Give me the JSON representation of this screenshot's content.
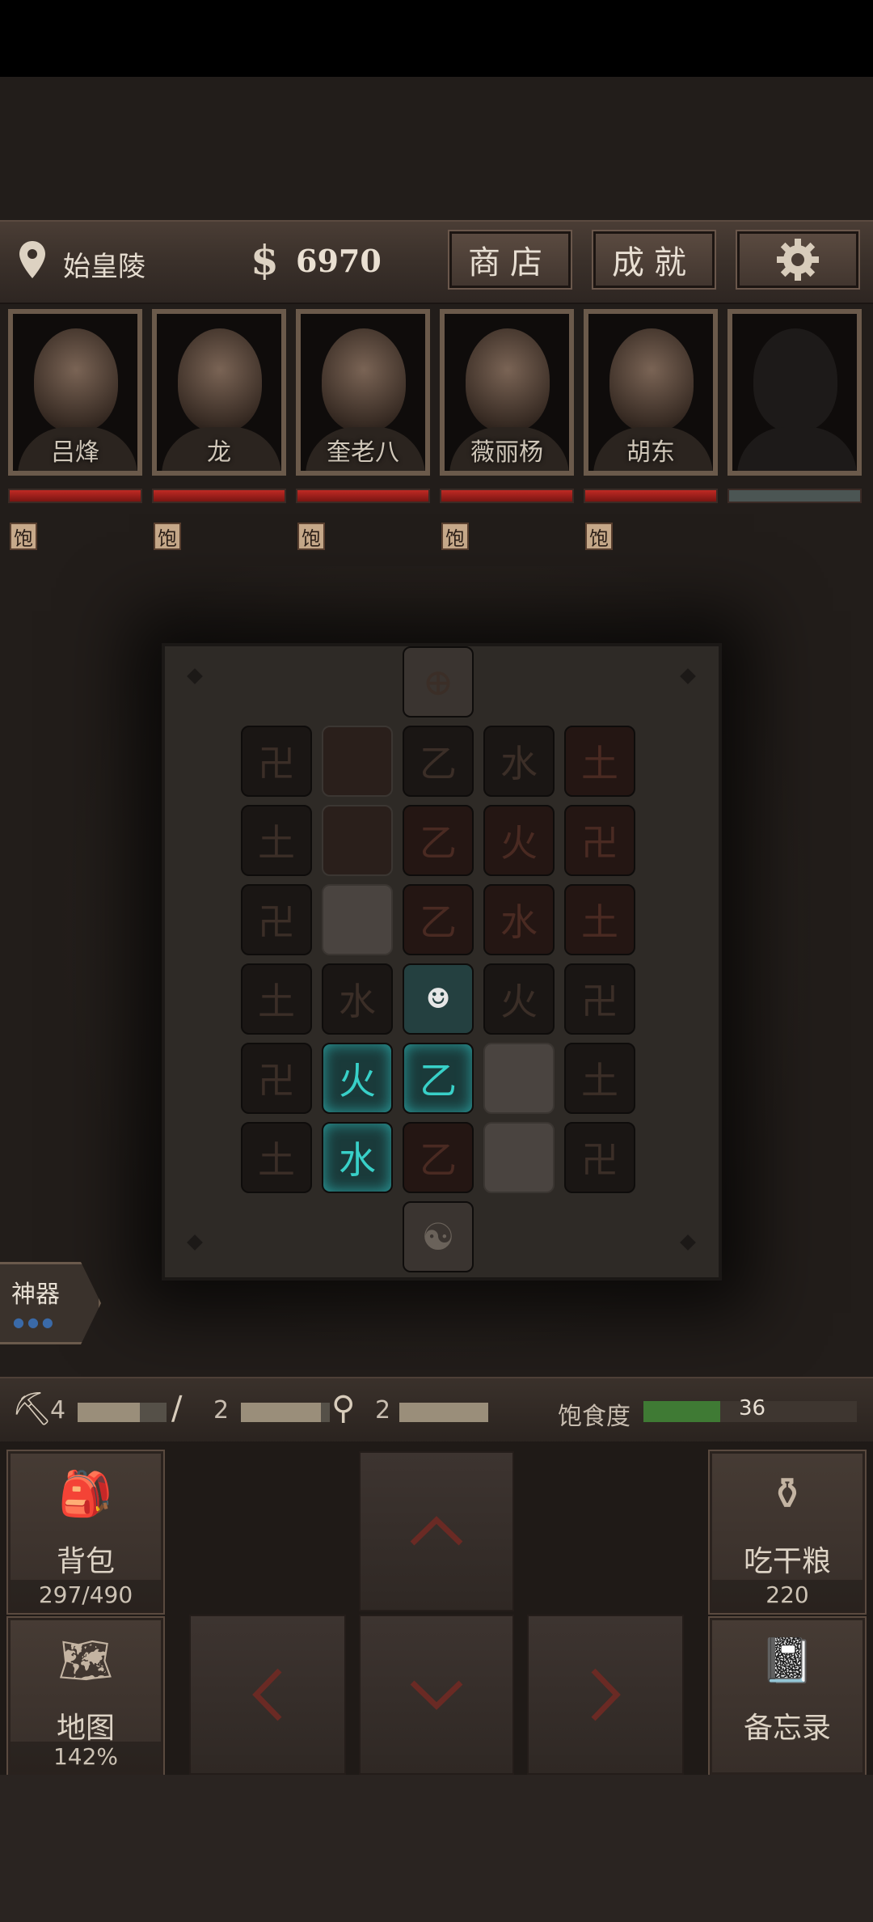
{
  "top": {
    "location": "始皇陵",
    "money_symbol": "$",
    "money": "6970",
    "shop": "商店",
    "achievements": "成就"
  },
  "party": [
    {
      "name": "吕烽",
      "status": "饱"
    },
    {
      "name": "龙",
      "status": "饱"
    },
    {
      "name": "奎老八",
      "status": "饱"
    },
    {
      "name": "薇丽杨",
      "status": "饱"
    },
    {
      "name": "胡东",
      "status": "饱"
    },
    {
      "name": "",
      "status": ""
    }
  ],
  "artifact": {
    "label": "神器",
    "dots": "●●●"
  },
  "tools": [
    {
      "icon": "pickaxe-icon",
      "count": "4",
      "level": 0.7
    },
    {
      "icon": "crowbar-icon",
      "count": "2",
      "level": 0.9
    },
    {
      "icon": "shovel-icon",
      "count": "2",
      "level": 1.0
    }
  ],
  "satiety": {
    "label": "饱食度",
    "value": "36",
    "level": 0.36
  },
  "controls": {
    "backpack": {
      "label": "背包",
      "sub": "297/490"
    },
    "eat": {
      "label": "吃干粮",
      "sub": "220"
    },
    "map": {
      "label": "地图",
      "sub": "142%"
    },
    "memo": {
      "label": "备忘录"
    }
  },
  "board_glyphs": {
    "a": "卍",
    "b": "乙",
    "c": "水",
    "d": "火",
    "e": "土",
    "f": "⊕"
  }
}
